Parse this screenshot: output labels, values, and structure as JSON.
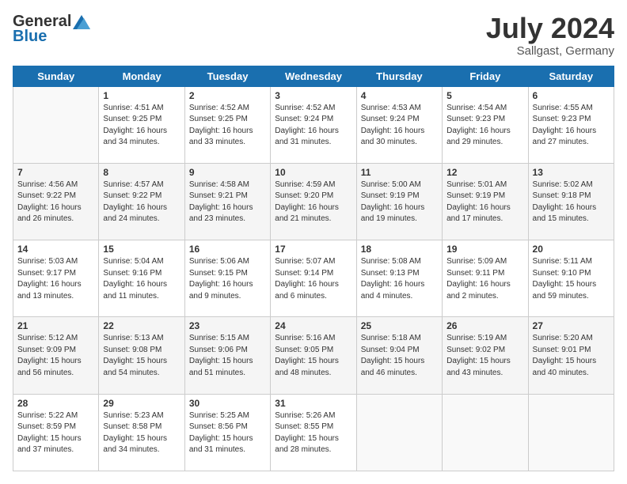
{
  "header": {
    "logo_general": "General",
    "logo_blue": "Blue",
    "month_title": "July 2024",
    "location": "Sallgast, Germany"
  },
  "days_of_week": [
    "Sunday",
    "Monday",
    "Tuesday",
    "Wednesday",
    "Thursday",
    "Friday",
    "Saturday"
  ],
  "weeks": [
    [
      {
        "day": "",
        "info": ""
      },
      {
        "day": "1",
        "info": "Sunrise: 4:51 AM\nSunset: 9:25 PM\nDaylight: 16 hours\nand 34 minutes."
      },
      {
        "day": "2",
        "info": "Sunrise: 4:52 AM\nSunset: 9:25 PM\nDaylight: 16 hours\nand 33 minutes."
      },
      {
        "day": "3",
        "info": "Sunrise: 4:52 AM\nSunset: 9:24 PM\nDaylight: 16 hours\nand 31 minutes."
      },
      {
        "day": "4",
        "info": "Sunrise: 4:53 AM\nSunset: 9:24 PM\nDaylight: 16 hours\nand 30 minutes."
      },
      {
        "day": "5",
        "info": "Sunrise: 4:54 AM\nSunset: 9:23 PM\nDaylight: 16 hours\nand 29 minutes."
      },
      {
        "day": "6",
        "info": "Sunrise: 4:55 AM\nSunset: 9:23 PM\nDaylight: 16 hours\nand 27 minutes."
      }
    ],
    [
      {
        "day": "7",
        "info": "Sunrise: 4:56 AM\nSunset: 9:22 PM\nDaylight: 16 hours\nand 26 minutes."
      },
      {
        "day": "8",
        "info": "Sunrise: 4:57 AM\nSunset: 9:22 PM\nDaylight: 16 hours\nand 24 minutes."
      },
      {
        "day": "9",
        "info": "Sunrise: 4:58 AM\nSunset: 9:21 PM\nDaylight: 16 hours\nand 23 minutes."
      },
      {
        "day": "10",
        "info": "Sunrise: 4:59 AM\nSunset: 9:20 PM\nDaylight: 16 hours\nand 21 minutes."
      },
      {
        "day": "11",
        "info": "Sunrise: 5:00 AM\nSunset: 9:19 PM\nDaylight: 16 hours\nand 19 minutes."
      },
      {
        "day": "12",
        "info": "Sunrise: 5:01 AM\nSunset: 9:19 PM\nDaylight: 16 hours\nand 17 minutes."
      },
      {
        "day": "13",
        "info": "Sunrise: 5:02 AM\nSunset: 9:18 PM\nDaylight: 16 hours\nand 15 minutes."
      }
    ],
    [
      {
        "day": "14",
        "info": "Sunrise: 5:03 AM\nSunset: 9:17 PM\nDaylight: 16 hours\nand 13 minutes."
      },
      {
        "day": "15",
        "info": "Sunrise: 5:04 AM\nSunset: 9:16 PM\nDaylight: 16 hours\nand 11 minutes."
      },
      {
        "day": "16",
        "info": "Sunrise: 5:06 AM\nSunset: 9:15 PM\nDaylight: 16 hours\nand 9 minutes."
      },
      {
        "day": "17",
        "info": "Sunrise: 5:07 AM\nSunset: 9:14 PM\nDaylight: 16 hours\nand 6 minutes."
      },
      {
        "day": "18",
        "info": "Sunrise: 5:08 AM\nSunset: 9:13 PM\nDaylight: 16 hours\nand 4 minutes."
      },
      {
        "day": "19",
        "info": "Sunrise: 5:09 AM\nSunset: 9:11 PM\nDaylight: 16 hours\nand 2 minutes."
      },
      {
        "day": "20",
        "info": "Sunrise: 5:11 AM\nSunset: 9:10 PM\nDaylight: 15 hours\nand 59 minutes."
      }
    ],
    [
      {
        "day": "21",
        "info": "Sunrise: 5:12 AM\nSunset: 9:09 PM\nDaylight: 15 hours\nand 56 minutes."
      },
      {
        "day": "22",
        "info": "Sunrise: 5:13 AM\nSunset: 9:08 PM\nDaylight: 15 hours\nand 54 minutes."
      },
      {
        "day": "23",
        "info": "Sunrise: 5:15 AM\nSunset: 9:06 PM\nDaylight: 15 hours\nand 51 minutes."
      },
      {
        "day": "24",
        "info": "Sunrise: 5:16 AM\nSunset: 9:05 PM\nDaylight: 15 hours\nand 48 minutes."
      },
      {
        "day": "25",
        "info": "Sunrise: 5:18 AM\nSunset: 9:04 PM\nDaylight: 15 hours\nand 46 minutes."
      },
      {
        "day": "26",
        "info": "Sunrise: 5:19 AM\nSunset: 9:02 PM\nDaylight: 15 hours\nand 43 minutes."
      },
      {
        "day": "27",
        "info": "Sunrise: 5:20 AM\nSunset: 9:01 PM\nDaylight: 15 hours\nand 40 minutes."
      }
    ],
    [
      {
        "day": "28",
        "info": "Sunrise: 5:22 AM\nSunset: 8:59 PM\nDaylight: 15 hours\nand 37 minutes."
      },
      {
        "day": "29",
        "info": "Sunrise: 5:23 AM\nSunset: 8:58 PM\nDaylight: 15 hours\nand 34 minutes."
      },
      {
        "day": "30",
        "info": "Sunrise: 5:25 AM\nSunset: 8:56 PM\nDaylight: 15 hours\nand 31 minutes."
      },
      {
        "day": "31",
        "info": "Sunrise: 5:26 AM\nSunset: 8:55 PM\nDaylight: 15 hours\nand 28 minutes."
      },
      {
        "day": "",
        "info": ""
      },
      {
        "day": "",
        "info": ""
      },
      {
        "day": "",
        "info": ""
      }
    ]
  ]
}
